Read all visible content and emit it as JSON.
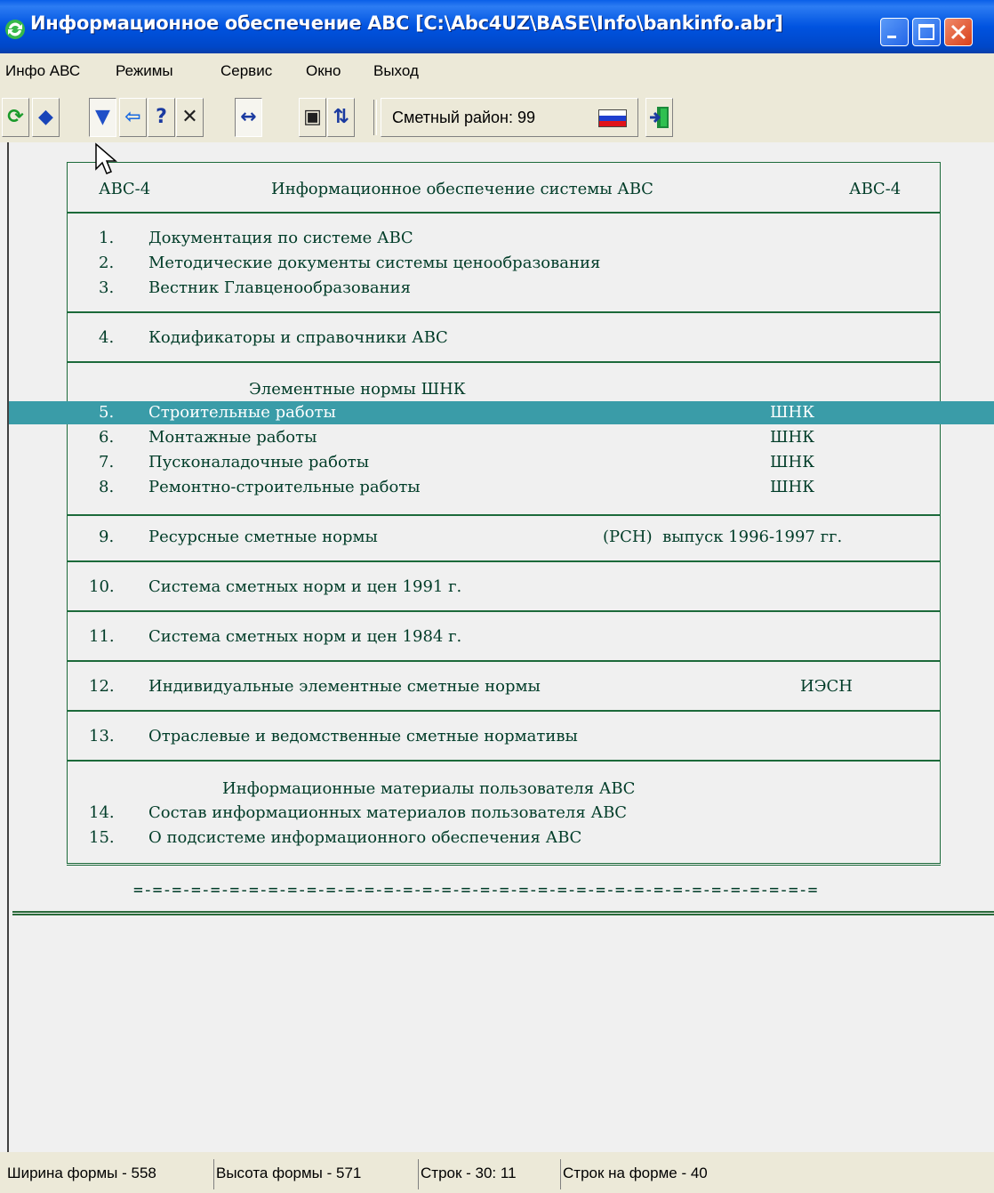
{
  "window": {
    "title": "Информационное обеспечение АВС [C:\\Abc4UZ\\BASE\\Info\\bankinfo.abr]"
  },
  "menu": [
    "Инфо АВС",
    "Режимы",
    "Сервис",
    "Окно",
    "Выход"
  ],
  "toolbar": {
    "tools": [
      {
        "icon": "refresh-icon",
        "glyph": "⟳",
        "color": "#1a9a2a",
        "pressed": false
      },
      {
        "icon": "book-icon",
        "glyph": "◆",
        "color": "#1844b8",
        "pressed": false
      },
      {
        "icon": "catalog-icon",
        "glyph": "▼",
        "color": "#2050c8",
        "pressed": true
      },
      {
        "icon": "back-arrow-icon",
        "glyph": "⇦",
        "color": "#1a6ae0",
        "pressed": false
      },
      {
        "icon": "help-icon",
        "glyph": "?",
        "color": "#1a3aa0",
        "pressed": false
      },
      {
        "icon": "close-x-icon",
        "glyph": "✕",
        "color": "#202020",
        "pressed": false
      },
      {
        "icon": "width-arrows-icon",
        "glyph": "↔",
        "color": "#1a3aa0",
        "pressed": true
      },
      {
        "icon": "binoculars-icon",
        "glyph": "▣",
        "color": "#202020",
        "pressed": false
      },
      {
        "icon": "search-next-icon",
        "glyph": "⇅",
        "color": "#1a3aa0",
        "pressed": false
      }
    ],
    "region_label": "Сметный район: 99",
    "exit_icon": "exit-door-icon"
  },
  "content": {
    "header": {
      "left": "АВС-4",
      "center": "Информационное обеспечение системы АВС",
      "right": "АВС-4"
    },
    "rows": [
      {
        "num": "1.",
        "text": "Документация по системе АВС",
        "tag": ""
      },
      {
        "num": "2.",
        "text": "Методические документы системы ценообразования",
        "tag": ""
      },
      {
        "num": "3.",
        "text": "Вестник Главценообразования",
        "tag": ""
      },
      {
        "num": "4.",
        "text": "Кодификаторы и справочники АВС",
        "tag": ""
      },
      {
        "num": "5.",
        "text": "Строительные работы",
        "tag": "ШНК"
      },
      {
        "num": "6.",
        "text": "Монтажные работы",
        "tag": "ШНК"
      },
      {
        "num": "7.",
        "text": "Пусконаладочные работы",
        "tag": "ШНК"
      },
      {
        "num": "8.",
        "text": "Ремонтно-строительные работы",
        "tag": "ШНК"
      },
      {
        "num": "9.",
        "text": "Ресурсные сметные нормы",
        "tag": "(РСН)  выпуск 1996-1997 гг."
      },
      {
        "num": "10.",
        "text": "Система сметных норм и цен 1991 г.",
        "tag": ""
      },
      {
        "num": "11.",
        "text": "Система сметных норм и цен 1984 г.",
        "tag": ""
      },
      {
        "num": "12.",
        "text": "Индивидуальные элементные сметные нормы",
        "tag": "ИЭСН"
      },
      {
        "num": "13.",
        "text": "Отраслевые и ведомственные сметные нормативы",
        "tag": ""
      },
      {
        "num": "14.",
        "text": "Состав информационных материалов пользователя АВС",
        "tag": ""
      },
      {
        "num": "15.",
        "text": "О подсистеме информационного обеспечения АВС",
        "tag": ""
      }
    ],
    "section_elem": "Элементные нормы ШНК",
    "section_info": "Информационные материалы пользователя АВС",
    "selected_row": 5,
    "footer_dashes": "=-=-=-=-=-=-=-=-=-=-=-=-=-=-=-=-=-=-=-=-=-=-=-=-=-=-=-=-=-=-=-=-=-=-=-="
  },
  "status": [
    "Ширина формы - 558",
    "Высота формы - 571",
    "Строк - 30: 11",
    "Строк на форме - 40"
  ],
  "colors": {
    "title_bar": "#0053e0",
    "selection": "#3a9ca8",
    "frame": "#1c6a3a",
    "text": "#003c28"
  }
}
